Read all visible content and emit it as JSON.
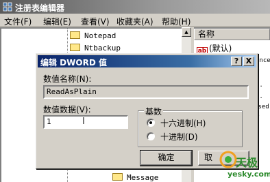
{
  "window": {
    "title": "注册表编辑器",
    "icon": "registry-icon"
  },
  "menu": [
    "文件(F)",
    "编辑(E)",
    "查看(V)",
    "收藏夹(A)",
    "帮助(H)"
  ],
  "tree": {
    "items": [
      "Notepad",
      "Ntbackup",
      "Message"
    ]
  },
  "values_pane": {
    "column_header": "名称",
    "default_value_label": "(默认)",
    "icon": "string-value-icon",
    "fragments": [
      "ence",
      "r",
      "..",
      "..",
      "ssed",
      "r"
    ]
  },
  "dialog": {
    "title": "编辑 DWORD 值",
    "help_button": "?",
    "close_button": "X",
    "name_label": "数值名称(N):",
    "name_value": "ReadAsPlain",
    "data_label": "数值数据(V):",
    "data_value": "1",
    "base_label": "基数",
    "base_options": [
      {
        "label": "十六进制(H)",
        "selected": true
      },
      {
        "label": "十进制(D)",
        "selected": false
      }
    ],
    "ok_label": "确定",
    "cancel_label": "取"
  },
  "watermark": {
    "brand": "天极",
    "site": "yesky.com"
  },
  "colors": {
    "dialog_title_start": "#0a246a",
    "dialog_title_end": "#a6caf0",
    "watermark": "#2c8a2c"
  }
}
